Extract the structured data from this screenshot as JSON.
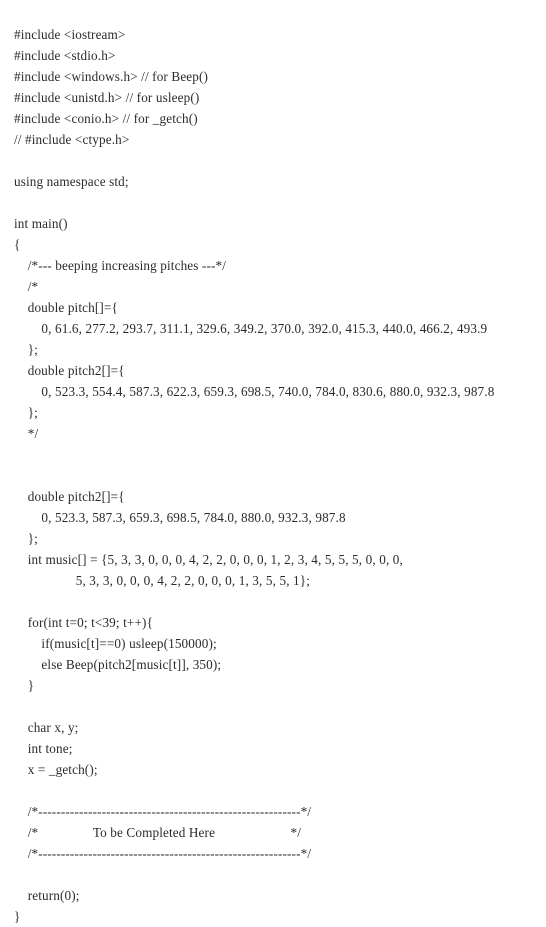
{
  "document": {
    "kind": "source-code-listing",
    "language": "C++",
    "background_color": "#ffffff",
    "text_color": "#2b2b2e"
  },
  "code": {
    "lines": [
      "#include <iostream>",
      "#include <stdio.h>",
      "#include <windows.h> // for Beep()",
      "#include <unistd.h> // for usleep()",
      "#include <conio.h> // for _getch()",
      "// #include <ctype.h>",
      "",
      "using namespace std;",
      "",
      "int main()",
      "{",
      "    /*--- beeping increasing pitches ---*/",
      "    /*",
      "    double pitch[]={",
      "        0, 61.6, 277.2, 293.7, 311.1, 329.6, 349.2, 370.0, 392.0, 415.3, 440.0, 466.2, 493.9",
      "    };",
      "    double pitch2[]={",
      "        0, 523.3, 554.4, 587.3, 622.3, 659.3, 698.5, 740.0, 784.0, 830.6, 880.0, 932.3, 987.8",
      "    };",
      "    */",
      "",
      "",
      "    double pitch2[]={",
      "        0, 523.3, 587.3, 659.3, 698.5, 784.0, 880.0, 932.3, 987.8",
      "    };",
      "    int music[] = {5, 3, 3, 0, 0, 0, 4, 2, 2, 0, 0, 0, 1, 2, 3, 4, 5, 5, 5, 0, 0, 0,",
      "                  5, 3, 3, 0, 0, 0, 4, 2, 2, 0, 0, 0, 1, 3, 5, 5, 1};",
      "",
      "    for(int t=0; t<39; t++){",
      "        if(music[t]==0) usleep(150000);",
      "        else Beep(pitch2[music[t]], 350);",
      "    }",
      "",
      "    char x, y;",
      "    int tone;",
      "    x = _getch();",
      "",
      "    /*----------------------------------------------------------*/",
      "    /*                To be Completed Here                      */",
      "    /*----------------------------------------------------------*/",
      "",
      "    return(0);",
      "}"
    ]
  }
}
